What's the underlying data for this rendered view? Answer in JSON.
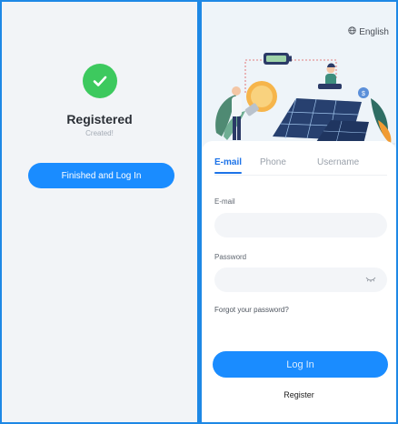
{
  "registered_screen": {
    "title": "Registered",
    "subtitle": "Created!",
    "finish_button": "Finished and Log In",
    "success_color": "#3dc95e"
  },
  "login_screen": {
    "language": "English",
    "tabs": [
      {
        "label": "E-mail",
        "active": true
      },
      {
        "label": "Phone",
        "active": false
      },
      {
        "label": "Username",
        "active": false
      }
    ],
    "email_field": {
      "label": "E-mail",
      "value": ""
    },
    "password_field": {
      "label": "Password",
      "value": ""
    },
    "forgot_password": "Forgot your password?",
    "login_button": "Log In",
    "register_link": "Register"
  },
  "colors": {
    "accent": "#1a8cff",
    "active_tab": "#1d73e8",
    "frame": "#1e88e5"
  },
  "icons": [
    "check-icon",
    "globe-icon",
    "eye-closed-icon"
  ]
}
